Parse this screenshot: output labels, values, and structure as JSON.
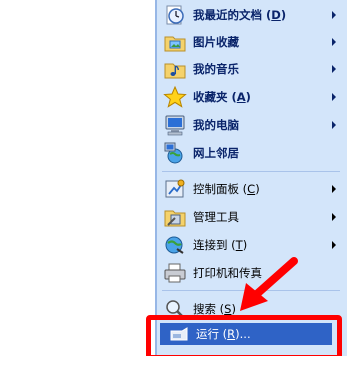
{
  "menu": {
    "items": [
      {
        "label_main": "我最近的文档 (",
        "mnemonic": "D",
        "label_tail": ")",
        "icon": "recent-documents-icon",
        "submenu": true
      },
      {
        "label_main": "图片收藏",
        "mnemonic": "",
        "label_tail": "",
        "icon": "my-pictures-icon",
        "submenu": true
      },
      {
        "label_main": "我的音乐",
        "mnemonic": "",
        "label_tail": "",
        "icon": "my-music-icon",
        "submenu": true
      },
      {
        "label_main": "收藏夹 (",
        "mnemonic": "A",
        "label_tail": ")",
        "icon": "favorites-star-icon",
        "submenu": true
      },
      {
        "label_main": "我的电脑",
        "mnemonic": "",
        "label_tail": "",
        "icon": "my-computer-icon",
        "submenu": true
      },
      {
        "label_main": "网上邻居",
        "mnemonic": "",
        "label_tail": "",
        "icon": "network-places-icon",
        "submenu": false
      },
      {
        "label_main": "控制面板 (",
        "mnemonic": "C",
        "label_tail": ")",
        "icon": "control-panel-icon",
        "submenu": true
      },
      {
        "label_main": "管理工具",
        "mnemonic": "",
        "label_tail": "",
        "icon": "admin-tools-icon",
        "submenu": true
      },
      {
        "label_main": "连接到 (",
        "mnemonic": "T",
        "label_tail": ")",
        "icon": "connect-to-icon",
        "submenu": true
      },
      {
        "label_main": "打印机和传真",
        "mnemonic": "",
        "label_tail": "",
        "icon": "printers-faxes-icon",
        "submenu": false
      },
      {
        "label_main": "搜索 (",
        "mnemonic": "S",
        "label_tail": ")",
        "icon": "search-icon",
        "submenu": false
      }
    ],
    "run": {
      "label_main": "运行 (",
      "mnemonic": "R",
      "label_tail": ")...",
      "icon": "run-icon"
    }
  },
  "colors": {
    "menu_pane": "#d3e5fa",
    "selected_item": "#2f63c6",
    "annotation_red": "#ff0000"
  }
}
